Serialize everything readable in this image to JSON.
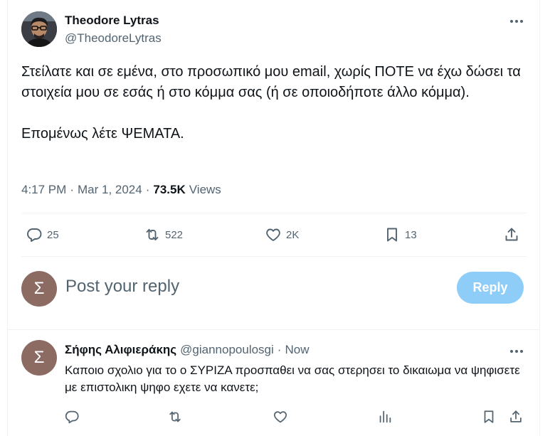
{
  "tweet": {
    "author_name": "Theodore Lytras",
    "author_handle": "@TheodoreLytras",
    "text": "Στείλατε και σε εμένα, στο προσωπικό μου email, χωρίς ΠΟΤΕ να έχω δώσει τα στοιχεία μου σε εσάς ή στο κόμμα σας (ή σε οποιοδήποτε άλλο κόμμα).\n\nΕπομένως λέτε ΨΕΜΑΤΑ.",
    "time": "4:17 PM",
    "separator": "·",
    "date": "Mar 1, 2024",
    "views_count": "73.5K",
    "views_label": "Views",
    "stats": {
      "replies": "25",
      "reposts": "522",
      "likes": "2K",
      "bookmarks": "13"
    }
  },
  "composer": {
    "avatar_letter": "Σ",
    "placeholder": "Post your reply",
    "reply_button": "Reply"
  },
  "reply": {
    "avatar_letter": "Σ",
    "author_name": "Σήφης Αλιφιεράκης",
    "author_handle": "@giannopoulosgi",
    "separator": "·",
    "time": "Now",
    "text": "Καποιο σχολιο για το ο ΣΥΡΙΖΑ προσπαθει να σας στερησει το δικαιωμα να ψηφισετε με επιστολικη ψηφο εχετε να κανετε;"
  },
  "colors": {
    "text_primary": "#0f1419",
    "text_secondary": "#536471",
    "reply_button_disabled": "#8ecdf8",
    "avatar_bg": "#8c6b63",
    "divider": "#eff3f4"
  },
  "icons": {
    "more": "more-horizontal-icon",
    "reply": "comment-icon",
    "repost": "repost-icon",
    "like": "heart-icon",
    "bookmark": "bookmark-icon",
    "share": "share-icon",
    "analytics": "analytics-icon"
  }
}
